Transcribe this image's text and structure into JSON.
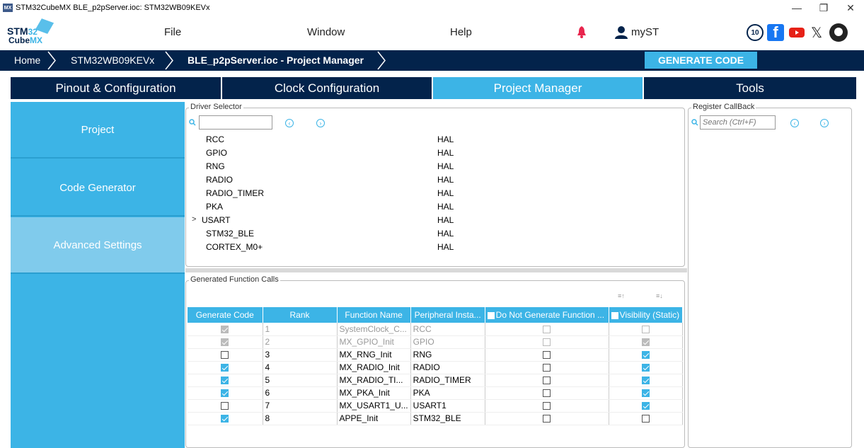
{
  "titlebar": {
    "app_icon": "MX",
    "title": "STM32CubeMX BLE_p2pServer.ioc: STM32WB09KEVx",
    "minimize": "—",
    "restore": "❐",
    "close": "✕"
  },
  "logo": {
    "stm": "STM",
    "num": "32",
    "cube": "Cube",
    "mx": "MX"
  },
  "menu": {
    "file": "File",
    "window": "Window",
    "help": "Help",
    "myst": "myST"
  },
  "social": {
    "anniversary": "10",
    "facebook": "f",
    "x": "𝕏"
  },
  "breadcrumb": {
    "home": "Home",
    "device": "STM32WB09KEVx",
    "project": "BLE_p2pServer.ioc - Project Manager",
    "generate": "GENERATE CODE"
  },
  "tabs": [
    "Pinout & Configuration",
    "Clock Configuration",
    "Project Manager",
    "Tools"
  ],
  "sidenav": [
    "Project",
    "Code Generator",
    "Advanced Settings"
  ],
  "driver_selector": {
    "legend": "Driver Selector",
    "search_value": "",
    "rows": [
      {
        "name": "RCC",
        "lib": "HAL",
        "expandable": false
      },
      {
        "name": "GPIO",
        "lib": "HAL",
        "expandable": false
      },
      {
        "name": "RNG",
        "lib": "HAL",
        "expandable": false
      },
      {
        "name": "RADIO",
        "lib": "HAL",
        "expandable": false
      },
      {
        "name": "RADIO_TIMER",
        "lib": "HAL",
        "expandable": false
      },
      {
        "name": "PKA",
        "lib": "HAL",
        "expandable": false
      },
      {
        "name": "USART",
        "lib": "HAL",
        "expandable": true
      },
      {
        "name": "STM32_BLE",
        "lib": "HAL",
        "expandable": false
      },
      {
        "name": "CORTEX_M0+",
        "lib": "HAL",
        "expandable": false
      }
    ]
  },
  "register_callback": {
    "legend": "Register CallBack",
    "search_placeholder": "Search (Ctrl+F)"
  },
  "function_calls": {
    "legend": "Generated Function Calls",
    "headers": [
      "Generate Code",
      "Rank",
      "Function Name",
      "Peripheral Insta...",
      "Do Not Generate Function ...",
      "Visibility (Static)"
    ],
    "rows": [
      {
        "gen": true,
        "rank": "1",
        "func": "SystemClock_C...",
        "periph": "RCC",
        "nogen": false,
        "vis": false,
        "disabled": true
      },
      {
        "gen": true,
        "rank": "2",
        "func": "MX_GPIO_Init",
        "periph": "GPIO",
        "nogen": false,
        "vis": true,
        "disabled": true
      },
      {
        "gen": false,
        "rank": "3",
        "func": "MX_RNG_Init",
        "periph": "RNG",
        "nogen": false,
        "vis": true,
        "disabled": false
      },
      {
        "gen": true,
        "rank": "4",
        "func": "MX_RADIO_Init",
        "periph": "RADIO",
        "nogen": false,
        "vis": true,
        "disabled": false
      },
      {
        "gen": true,
        "rank": "5",
        "func": "MX_RADIO_TI...",
        "periph": "RADIO_TIMER",
        "nogen": false,
        "vis": true,
        "disabled": false
      },
      {
        "gen": true,
        "rank": "6",
        "func": "MX_PKA_Init",
        "periph": "PKA",
        "nogen": false,
        "vis": true,
        "disabled": false
      },
      {
        "gen": false,
        "rank": "7",
        "func": "MX_USART1_U...",
        "periph": "USART1",
        "nogen": false,
        "vis": true,
        "disabled": false
      },
      {
        "gen": true,
        "rank": "8",
        "func": "APPE_Init",
        "periph": "STM32_BLE",
        "nogen": false,
        "vis": false,
        "disabled": false
      }
    ]
  },
  "colors": {
    "navy": "#03234b",
    "accent": "#3cb4e6",
    "active_side": "#80cbec"
  }
}
